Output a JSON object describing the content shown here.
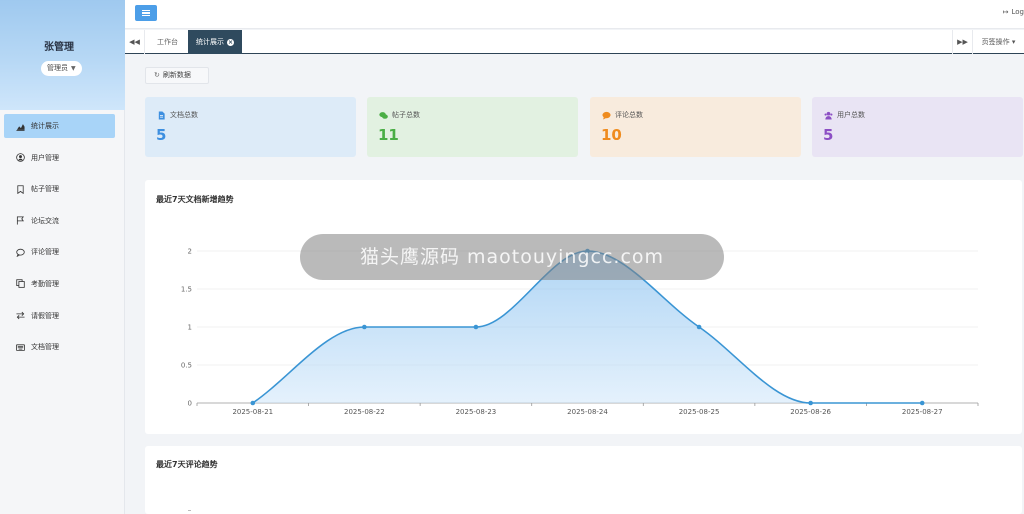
{
  "sidebar": {
    "user_name": "张管理",
    "role": "管理员",
    "items": [
      {
        "label": "统计展示",
        "icon": "area-chart-icon",
        "active": true
      },
      {
        "label": "用户管理",
        "icon": "user-circle-icon",
        "active": false
      },
      {
        "label": "帖子管理",
        "icon": "bookmark-icon",
        "active": false
      },
      {
        "label": "论坛交流",
        "icon": "flag-icon",
        "active": false
      },
      {
        "label": "评论管理",
        "icon": "comment-icon",
        "active": false
      },
      {
        "label": "考勤管理",
        "icon": "copy-icon",
        "active": false
      },
      {
        "label": "请假管理",
        "icon": "exchange-icon",
        "active": false
      },
      {
        "label": "文档管理",
        "icon": "keyboard-icon",
        "active": false
      }
    ]
  },
  "header": {
    "logout_label": "Log"
  },
  "tabs": {
    "items": [
      {
        "label": "工作台",
        "active": false
      },
      {
        "label": "统计展示",
        "active": true
      }
    ],
    "ops_label": "页签操作"
  },
  "toolbar": {
    "refresh_label": "刷新数据"
  },
  "stats": [
    {
      "label": "文档总数",
      "value": "5",
      "icon": "file-icon",
      "color": "#3d8fe0"
    },
    {
      "label": "帖子总数",
      "value": "11",
      "icon": "comments-icon",
      "color": "#4aae45"
    },
    {
      "label": "评论总数",
      "value": "10",
      "icon": "comment-icon",
      "color": "#ef8b1e"
    },
    {
      "label": "用户总数",
      "value": "5",
      "icon": "users-icon",
      "color": "#8c4fc4"
    }
  ],
  "chart_data": [
    {
      "type": "area",
      "title": "最近7天文档新增趋势",
      "categories": [
        "2025-08-21",
        "2025-08-22",
        "2025-08-23",
        "2025-08-24",
        "2025-08-25",
        "2025-08-26",
        "2025-08-27"
      ],
      "values": [
        0,
        1,
        1,
        2,
        1,
        0,
        0
      ],
      "yticks": [
        "0",
        "0.5",
        "1",
        "1.5",
        "2"
      ],
      "ylim": [
        0,
        2
      ],
      "grid": true,
      "color": "#3a95d4"
    },
    {
      "type": "line",
      "title": "最近7天评论趋势"
    }
  ],
  "watermark": "猫头鹰源码 maotouyingcc.com"
}
